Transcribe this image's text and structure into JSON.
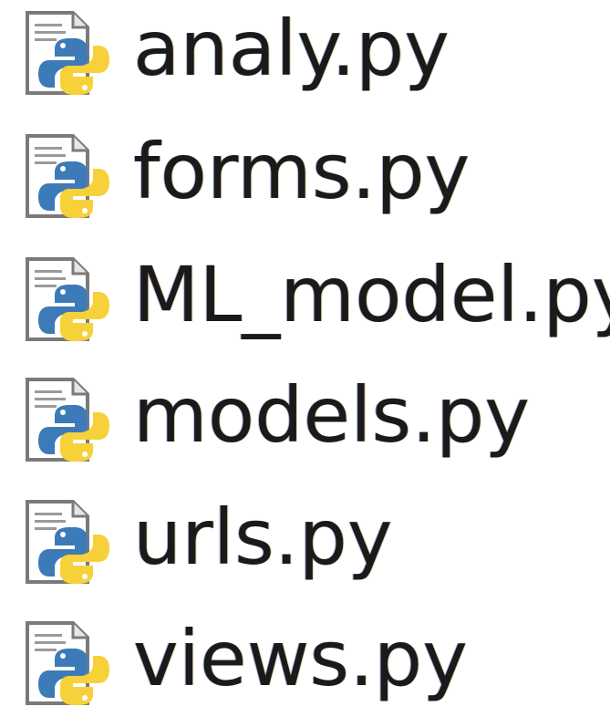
{
  "files": [
    {
      "name": "analy.py",
      "icon": "python-file-icon"
    },
    {
      "name": "forms.py",
      "icon": "python-file-icon"
    },
    {
      "name": "ML_model.py",
      "icon": "python-file-icon"
    },
    {
      "name": "models.py",
      "icon": "python-file-icon"
    },
    {
      "name": "urls.py",
      "icon": "python-file-icon"
    },
    {
      "name": "views.py",
      "icon": "python-file-icon"
    }
  ],
  "colors": {
    "python_blue": "#3d7ab8",
    "python_yellow": "#f7d13a",
    "page_outline": "#7a7a7a",
    "text": "#1a1a1a"
  }
}
